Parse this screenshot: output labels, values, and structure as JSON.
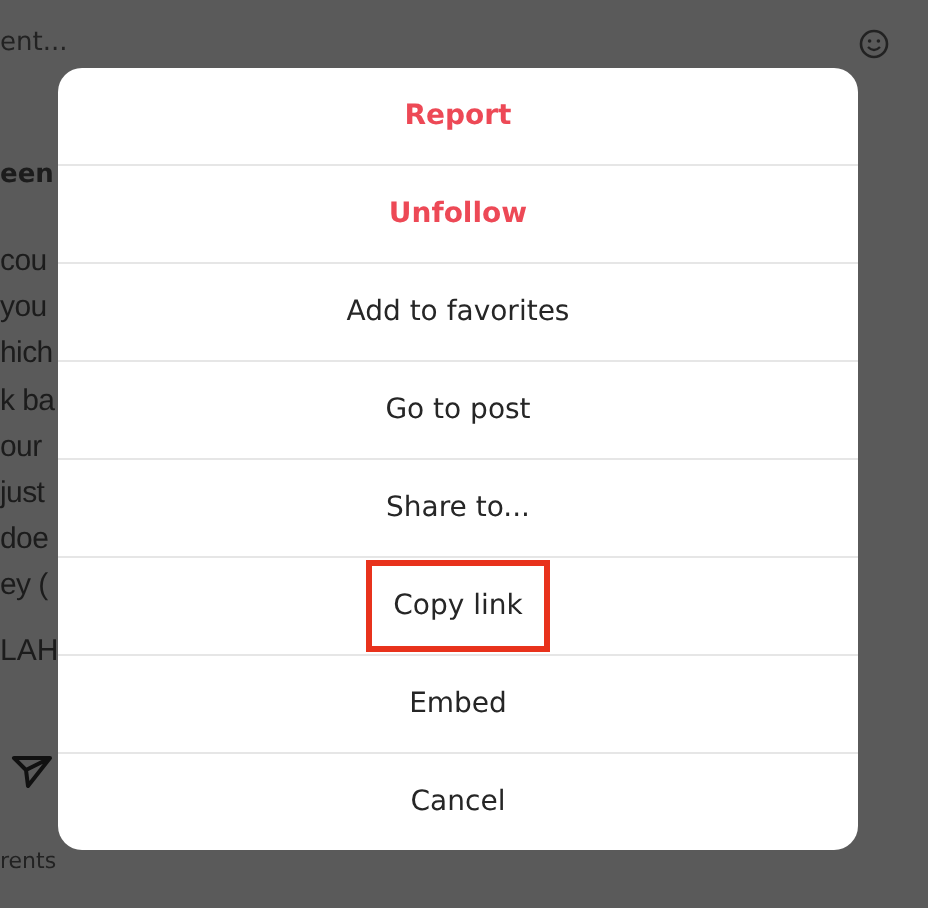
{
  "background": {
    "comment_field": {
      "placeholder": "ent..."
    },
    "author": "een",
    "caption_lines": [
      "cou",
      "you",
      "hich",
      "k ba",
      "our",
      "just",
      "doe",
      "ey ("
    ],
    "caption_end": "LAH",
    "footer": "rents"
  },
  "menu": {
    "items": [
      {
        "label": "Report",
        "kind": "danger",
        "highlighted": false
      },
      {
        "label": "Unfollow",
        "kind": "danger",
        "highlighted": false
      },
      {
        "label": "Add to favorites",
        "kind": "normal",
        "highlighted": false
      },
      {
        "label": "Go to post",
        "kind": "normal",
        "highlighted": false
      },
      {
        "label": "Share to...",
        "kind": "normal",
        "highlighted": false
      },
      {
        "label": "Copy link",
        "kind": "normal",
        "highlighted": true
      },
      {
        "label": "Embed",
        "kind": "normal",
        "highlighted": false
      },
      {
        "label": "Cancel",
        "kind": "normal",
        "highlighted": false
      }
    ]
  }
}
